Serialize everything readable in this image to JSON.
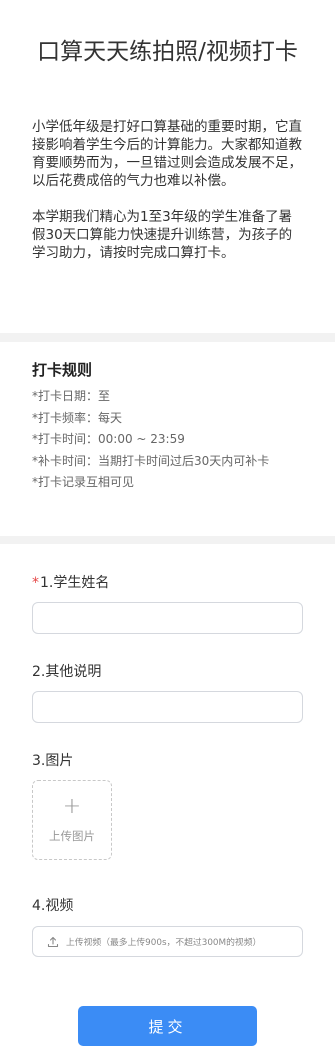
{
  "page": {
    "title": "口算天天练拍照/视频打卡",
    "intro_paragraphs": [
      "小学低年级是打好口算基础的重要时期，它直接影响着学生今后的计算能力。大家都知道教育要顺势而为，一旦错过则会造成发展不足，以后花费成倍的气力也难以补偿。",
      "本学期我们精心为1至3年级的学生准备了暑假30天口算能力快速提升训练营，为孩子的学习助力，请按时完成口算打卡。"
    ]
  },
  "rules": {
    "title": "打卡规则",
    "items": [
      "*打卡日期：至",
      "*打卡频率：每天",
      "*打卡时间：00:00 ~ 23:59",
      "*补卡时间：当期打卡时间过后30天内可补卡",
      "*打卡记录互相可见"
    ]
  },
  "form": {
    "student_name": {
      "required_mark": "*",
      "label": "1.学生姓名",
      "value": "",
      "placeholder": ""
    },
    "other_notes": {
      "label": "2.其他说明",
      "value": "",
      "placeholder": ""
    },
    "image": {
      "label": "3.图片",
      "upload_label": "上传图片",
      "icon": "plus-icon"
    },
    "video": {
      "label": "4.视频",
      "upload_label": "上传视频（最多上传900s，不超过300M的视频）",
      "icon": "upload-icon"
    },
    "submit_label": "提交"
  },
  "colors": {
    "accent": "#3b8cf5",
    "required": "#e54545",
    "divider": "#f2f2f2",
    "muted_text": "#999999"
  }
}
